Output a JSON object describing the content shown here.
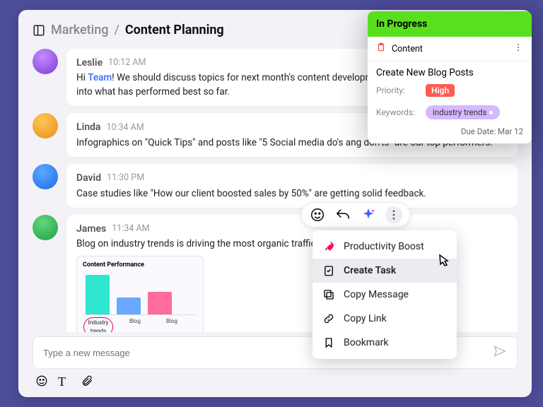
{
  "breadcrumb": {
    "parent": "Marketing",
    "sep": "/",
    "current": "Content Planning"
  },
  "messages": [
    {
      "author": "Leslie",
      "time": "10:12 AM",
      "pre": "Hi ",
      "mention": "Team",
      "post": "! We should discuss topics for next month's content development plan. Let's share insights into what has performed best so far."
    },
    {
      "author": "Linda",
      "time": "10:34 AM",
      "body": "Infographics on \"Quick Tips\" and posts like \"5 Social media do's ang don'ts\" are our top performers."
    },
    {
      "author": "David",
      "time": "11:30 PM",
      "body": "Case studies like \"How our client boosted sales by 50%\" are getting solid feedback."
    },
    {
      "author": "James",
      "time": "11:34 AM",
      "body": "Blog on industry trends is driving the most organic traffic."
    }
  ],
  "chart_data": {
    "type": "bar",
    "title": "Content Performance",
    "categories": [
      "Industry trends",
      "Blog",
      "Blog"
    ],
    "values": [
      95,
      40,
      55
    ],
    "highlighted_category": "Industry trends",
    "colors": [
      "#2fe7d1",
      "#6aa8ff",
      "#ff6b9a"
    ]
  },
  "menu": [
    {
      "id": "boost",
      "label": "Productivity Boost"
    },
    {
      "id": "create-task",
      "label": "Create Task"
    },
    {
      "id": "copy-message",
      "label": "Copy Message"
    },
    {
      "id": "copy-link",
      "label": "Copy Link"
    },
    {
      "id": "bookmark",
      "label": "Bookmark"
    }
  ],
  "task": {
    "status": "In Progress",
    "board": "Content",
    "title": "Create New Blog Posts",
    "priority_label": "Priority:",
    "priority_value": "High",
    "keywords_label": "Keywords:",
    "keywords_value": "industry trends",
    "due": "Due Date: Mar 12"
  },
  "composer": {
    "placeholder": "Type a new message"
  }
}
